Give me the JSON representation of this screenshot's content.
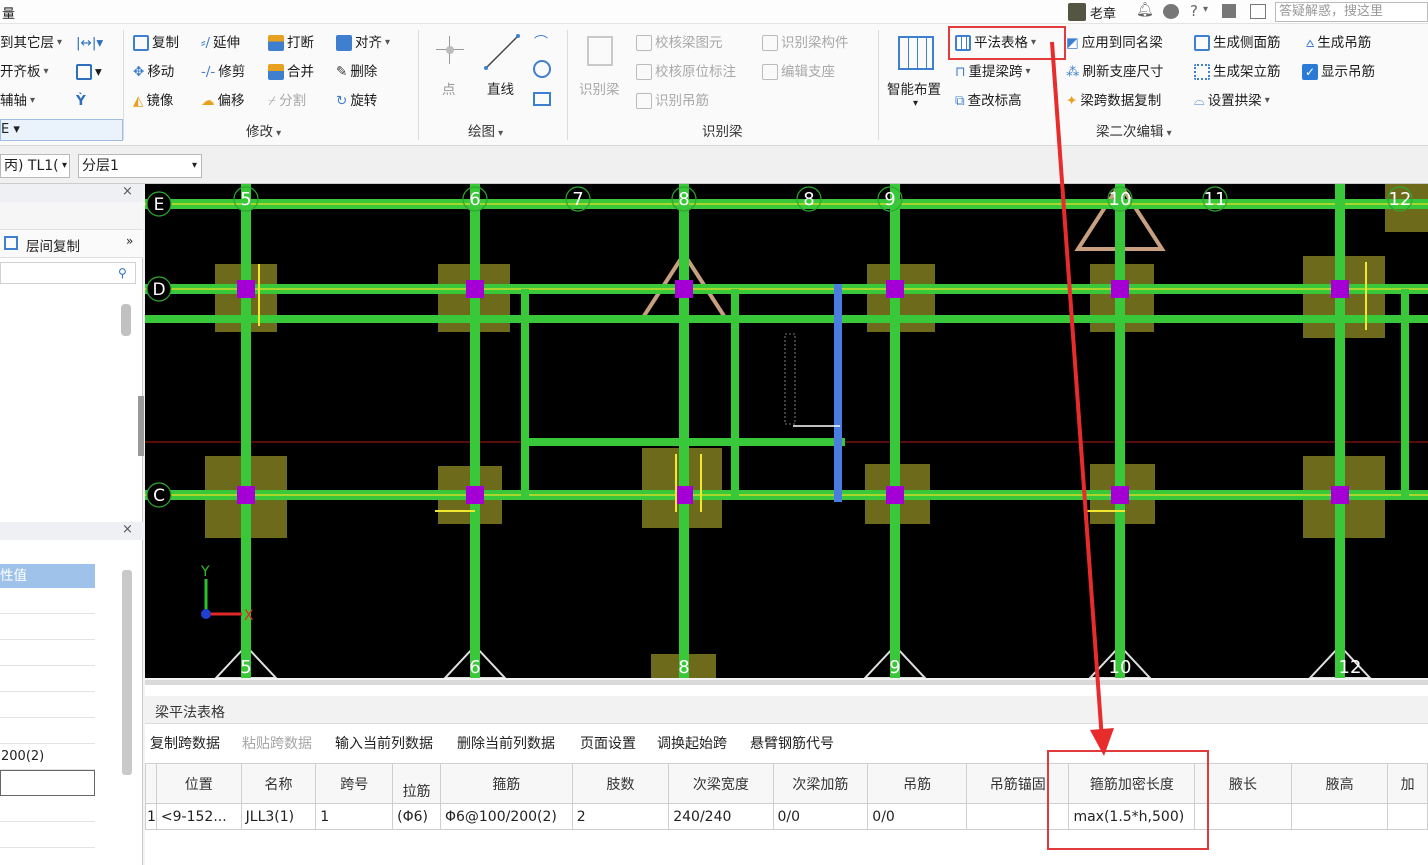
{
  "app": {
    "title_fragment": "量"
  },
  "topbar": {
    "user": "老章",
    "search_placeholder": "答疑解惑，搜这里",
    "help": "?",
    "dropdown": "▾"
  },
  "ribbon": {
    "left_partial": {
      "copy_layers": "到其它层",
      "align_slab": "开齐板",
      "axis": "辅轴",
      "group_partial": "E"
    },
    "modify": {
      "label": "修改",
      "items": {
        "copy": "复制",
        "extend": "延伸",
        "break": "打断",
        "align": "对齐",
        "move": "移动",
        "trim": "修剪",
        "merge": "合并",
        "delete": "删除",
        "mirror": "镜像",
        "offset": "偏移",
        "split": "分割",
        "rotate": "旋转"
      }
    },
    "draw": {
      "label": "绘图",
      "point": "点",
      "line": "直线"
    },
    "recognize_beam": {
      "label": "识别梁",
      "items": {
        "recognize": "识别梁",
        "check_element": "校核梁图元",
        "recognize_component": "识别梁构件",
        "check_original": "校核原位标注",
        "edit_support": "编辑支座",
        "recognize_hanger": "识别吊筋"
      }
    },
    "beam_edit": {
      "label": "梁二次编辑",
      "smart_layout": "智能布置",
      "items": {
        "pingfa_table": "平法表格",
        "apply_same_name": "应用到同名梁",
        "gen_side_rebar": "生成侧面筋",
        "gen_hanger": "生成吊筋",
        "re_span": "重提梁跨",
        "refresh_support": "刷新支座尺寸",
        "gen_erect": "生成架立筋",
        "show_hanger": "显示吊筋",
        "change_elevation": "查改标高",
        "cross_span_copy": "梁跨数据复制",
        "set_arch": "设置拱梁"
      }
    }
  },
  "toolbar2": {
    "component_combo": "丙) TL1(",
    "layer_combo": "分层1"
  },
  "left_panel": {
    "close": "×",
    "floor_copy": "层间复制",
    "more": "»",
    "prop_header": "性值",
    "prop_value": "200(2)"
  },
  "canvas": {
    "grid_top": [
      "5",
      "6",
      "7",
      "8",
      "8",
      "9",
      "10",
      "11",
      "12"
    ],
    "grid_bottom": [
      "5",
      "6",
      "8",
      "9",
      "10",
      "12"
    ],
    "grid_rows": [
      "E",
      "D",
      "C"
    ],
    "axis_x": "X",
    "axis_y": "Y"
  },
  "bottom": {
    "title": "梁平法表格",
    "toolbar": [
      "复制跨数据",
      "粘贴跨数据",
      "输入当前列数据",
      "删除当前列数据",
      "页面设置",
      "调换起始跨",
      "悬臂钢筋代号"
    ],
    "toolbar_disabled": [
      false,
      true,
      false,
      false,
      false,
      false,
      false
    ],
    "columns": [
      "位置",
      "名称",
      "跨号",
      "拉筋",
      "箍筋",
      "肢数",
      "次梁宽度",
      "次梁加筋",
      "吊筋",
      "吊筋锚固",
      "箍筋加密长度",
      "腋长",
      "腋高",
      "加"
    ],
    "rows": [
      {
        "index": "1",
        "position": "<9-152...",
        "name": "JLL3(1)",
        "span": "1",
        "tie": "(Φ6)",
        "stirrup": "Φ6@100/200(2)",
        "legs": "2",
        "sec_width": "240/240",
        "sec_add": "0/0",
        "hanger": "0/0",
        "hanger_anchor": "",
        "dense_length": "max(1.5*h,500)",
        "haunch_len": "",
        "haunch_h": ""
      }
    ]
  },
  "colors": {
    "beam": "#38c83a",
    "highlight_red": "#e23b3b",
    "column": "#a400d6",
    "pad": "#6e6a1c",
    "canvas_bg": "#000000"
  }
}
